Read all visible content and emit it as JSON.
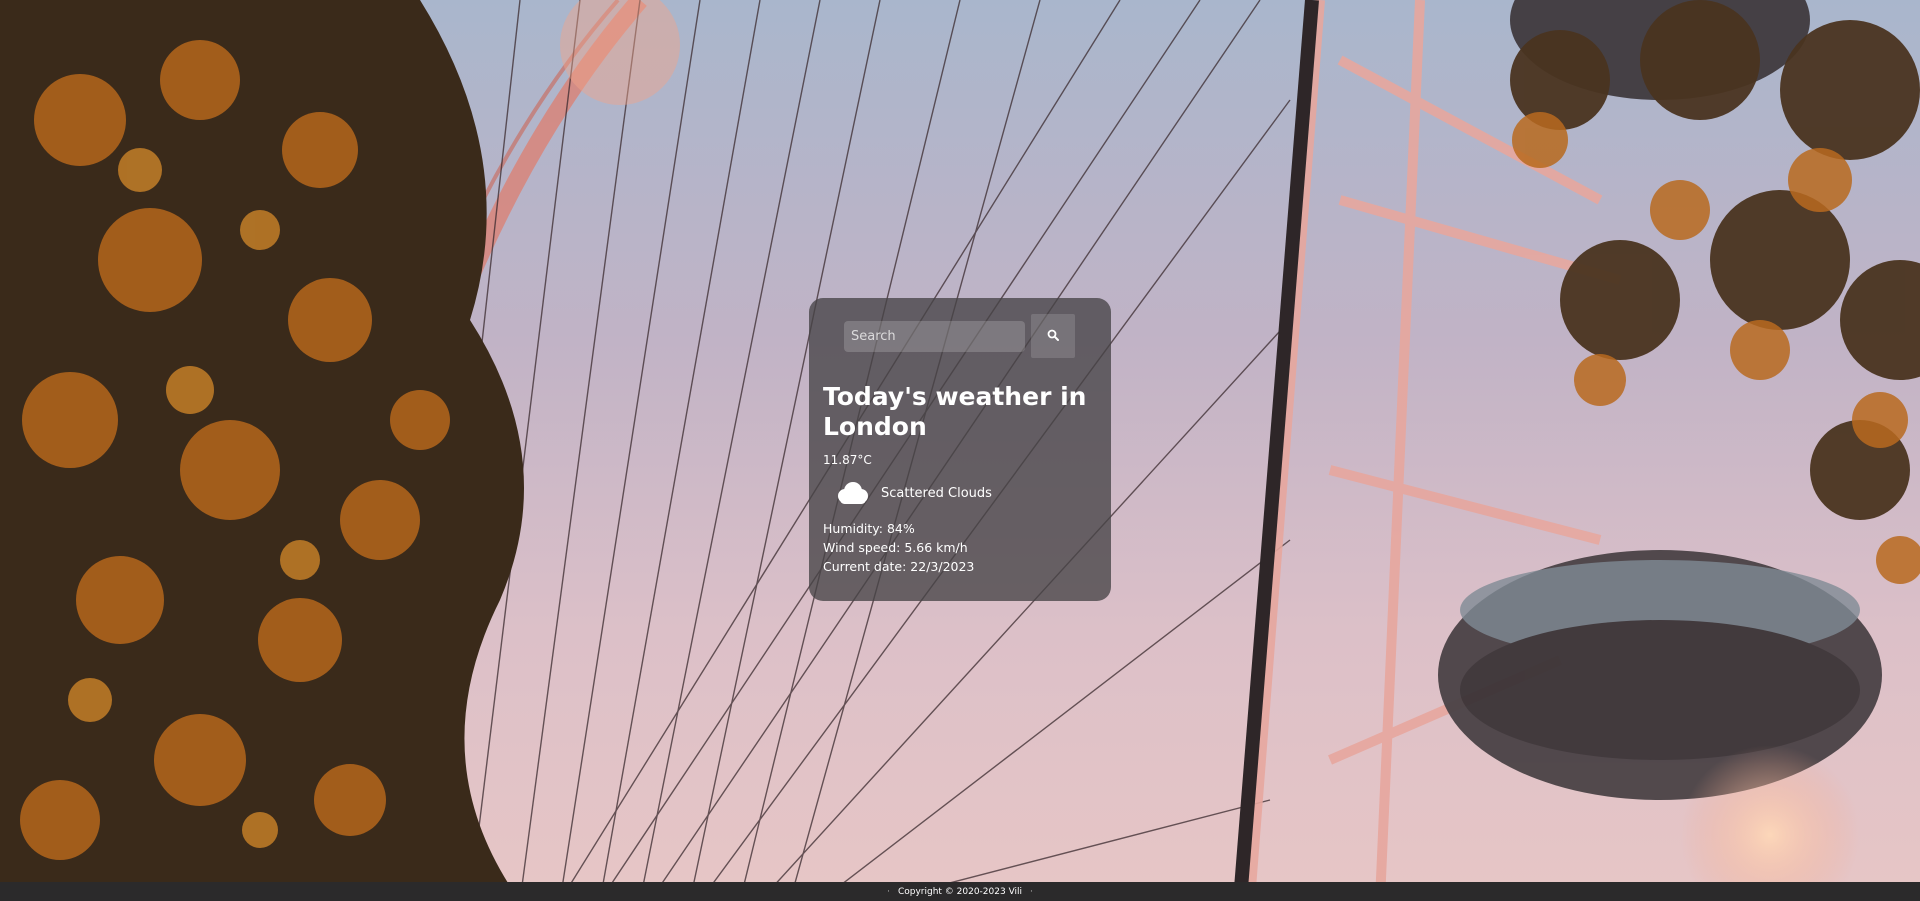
{
  "search": {
    "placeholder": "Search",
    "button_icon": "search-icon"
  },
  "weather": {
    "title": "Today's weather in London",
    "temperature": "11.87°C",
    "condition_icon": "cloud-icon",
    "condition": "Scattered Clouds",
    "humidity": "Humidity: 84%",
    "wind": "Wind speed: 5.66 km/h",
    "date": "Current date: 22/3/2023"
  },
  "footer": {
    "copyright": "Copyright © 2020-2023 Vili"
  },
  "colors": {
    "card": "#464446",
    "footer": "#2b2a2b",
    "text": "#ffffff"
  }
}
